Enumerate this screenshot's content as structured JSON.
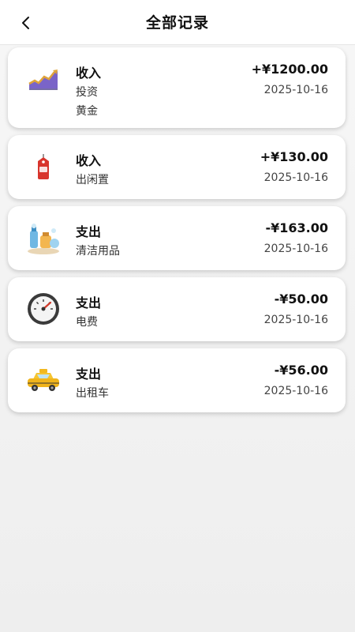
{
  "header": {
    "title": "全部记录",
    "back_icon": "chevron-left-icon"
  },
  "records": [
    {
      "type": "收入",
      "category": "投资",
      "note": "黄金",
      "amount": "+¥1200.00",
      "date": "2025-10-16",
      "icon": "growth-chart-icon"
    },
    {
      "type": "收入",
      "category": "出闲置",
      "amount": "+¥130.00",
      "date": "2025-10-16",
      "icon": "price-tag-icon"
    },
    {
      "type": "支出",
      "category": "清洁用品",
      "amount": "-¥163.00",
      "date": "2025-10-16",
      "icon": "cleaning-supplies-icon"
    },
    {
      "type": "支出",
      "category": "电费",
      "amount": "-¥50.00",
      "date": "2025-10-16",
      "icon": "electric-meter-icon"
    },
    {
      "type": "支出",
      "category": "出租车",
      "amount": "-¥56.00",
      "date": "2025-10-16",
      "icon": "taxi-icon"
    }
  ]
}
